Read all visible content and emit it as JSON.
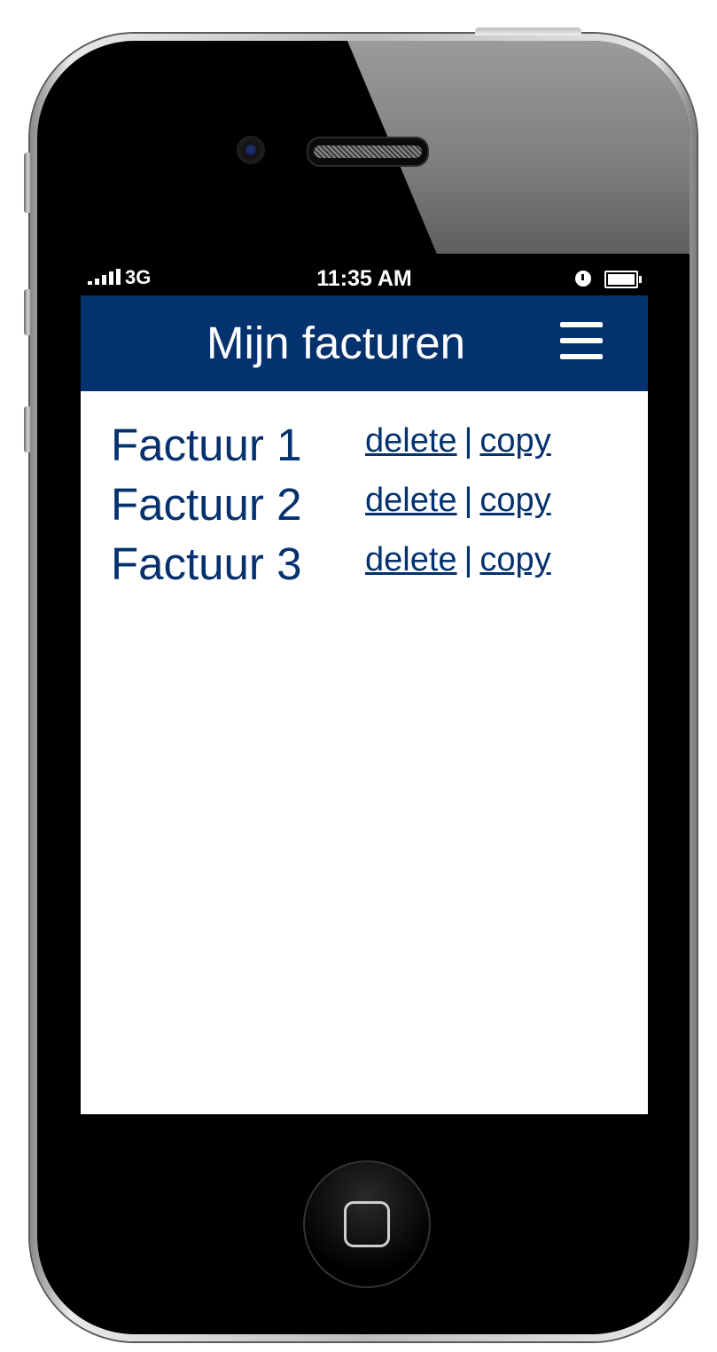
{
  "status_bar": {
    "carrier": "3G",
    "time": "11:35 AM"
  },
  "header": {
    "title": "Mijn facturen",
    "menu_icon": "hamburger-menu-icon"
  },
  "invoices": [
    {
      "name": "Factuur 1",
      "delete_label": "delete",
      "copy_label": "copy",
      "separator": "|"
    },
    {
      "name": "Factuur 2",
      "delete_label": "delete",
      "copy_label": "copy",
      "separator": "|"
    },
    {
      "name": "Factuur 3",
      "delete_label": "delete",
      "copy_label": "copy",
      "separator": "|"
    }
  ],
  "colors": {
    "brand": "#04326f",
    "background": "#ffffff",
    "status_bar": "#000000"
  }
}
